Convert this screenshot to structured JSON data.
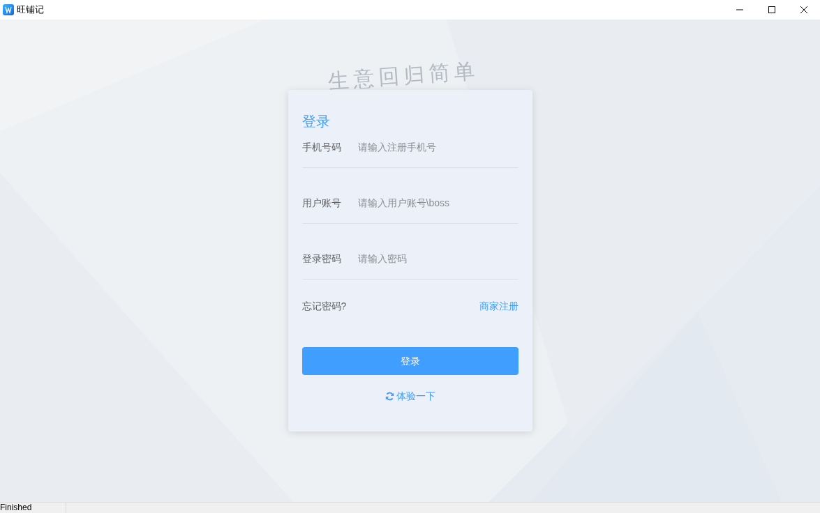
{
  "window": {
    "title": "旺铺记"
  },
  "slogan": "生意回归简单",
  "login": {
    "title": "登录",
    "fields": [
      {
        "label": "手机号码",
        "placeholder": "请输入注册手机号"
      },
      {
        "label": "用户账号",
        "placeholder": "请输入用户账号\\boss"
      },
      {
        "label": "登录密码",
        "placeholder": "请输入密码"
      }
    ],
    "forgot_link": "忘记密码?",
    "register_link": "商家注册",
    "submit": "登录",
    "trial_link": "体验一下"
  },
  "status_bar": "Finished"
}
